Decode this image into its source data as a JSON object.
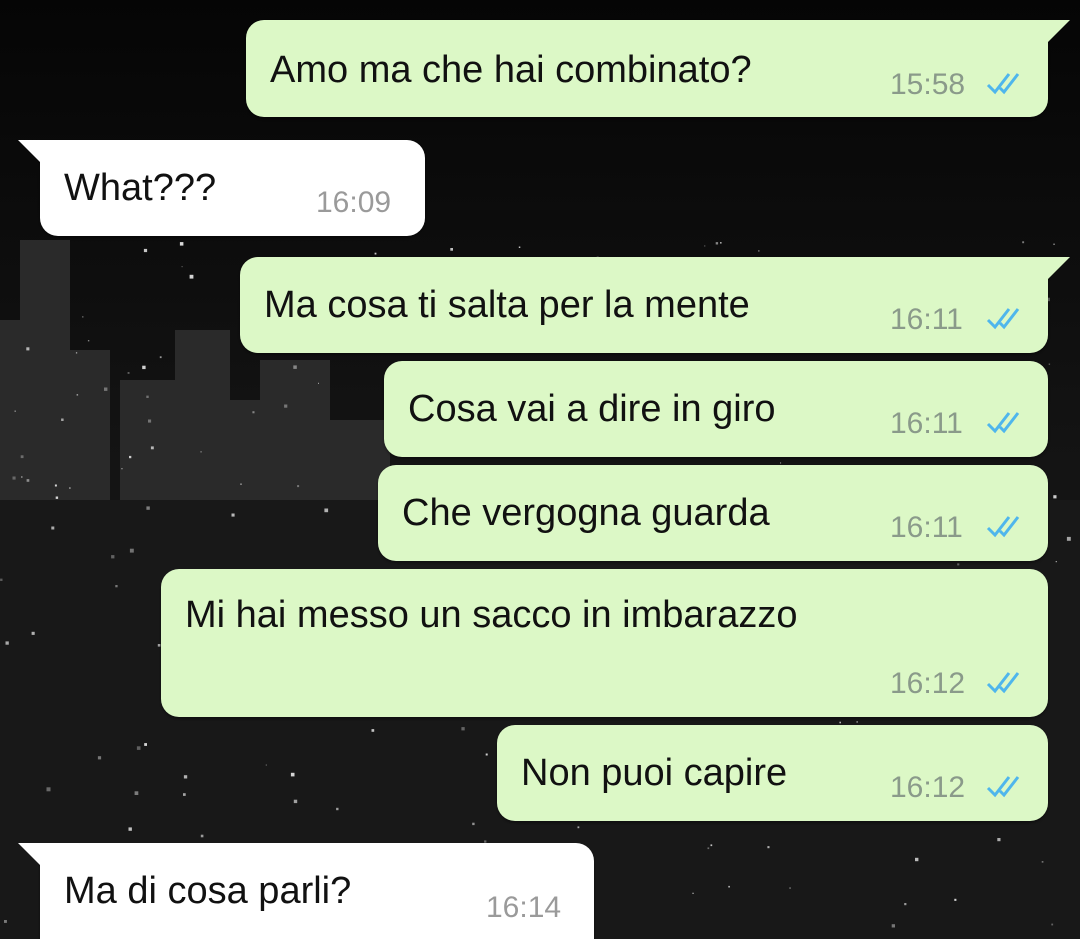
{
  "colors": {
    "outgoing_bubble": "#dcf8c6",
    "incoming_bubble": "#ffffff",
    "read_ticks": "#4fb6ec",
    "timestamp": "#8a9a8a"
  },
  "messages": [
    {
      "direction": "outgoing",
      "text": "Amo ma che hai combinato?",
      "time": "15:58",
      "status_icon": "double-check-read-icon"
    },
    {
      "direction": "incoming",
      "text": "What???",
      "time": "16:09"
    },
    {
      "direction": "outgoing",
      "text": "Ma cosa ti salta per la mente",
      "time": "16:11",
      "status_icon": "double-check-read-icon"
    },
    {
      "direction": "outgoing",
      "text": "Cosa vai a dire in giro",
      "time": "16:11",
      "status_icon": "double-check-read-icon"
    },
    {
      "direction": "outgoing",
      "text": "Che vergogna guarda",
      "time": "16:11",
      "status_icon": "double-check-read-icon"
    },
    {
      "direction": "outgoing",
      "text": "Mi hai messo un sacco in imbarazzo",
      "time": "16:12",
      "status_icon": "double-check-read-icon"
    },
    {
      "direction": "outgoing",
      "text": "Non puoi capire",
      "time": "16:12",
      "status_icon": "double-check-read-icon"
    },
    {
      "direction": "incoming",
      "text": "Ma di cosa parli?",
      "time": "16:14"
    }
  ]
}
